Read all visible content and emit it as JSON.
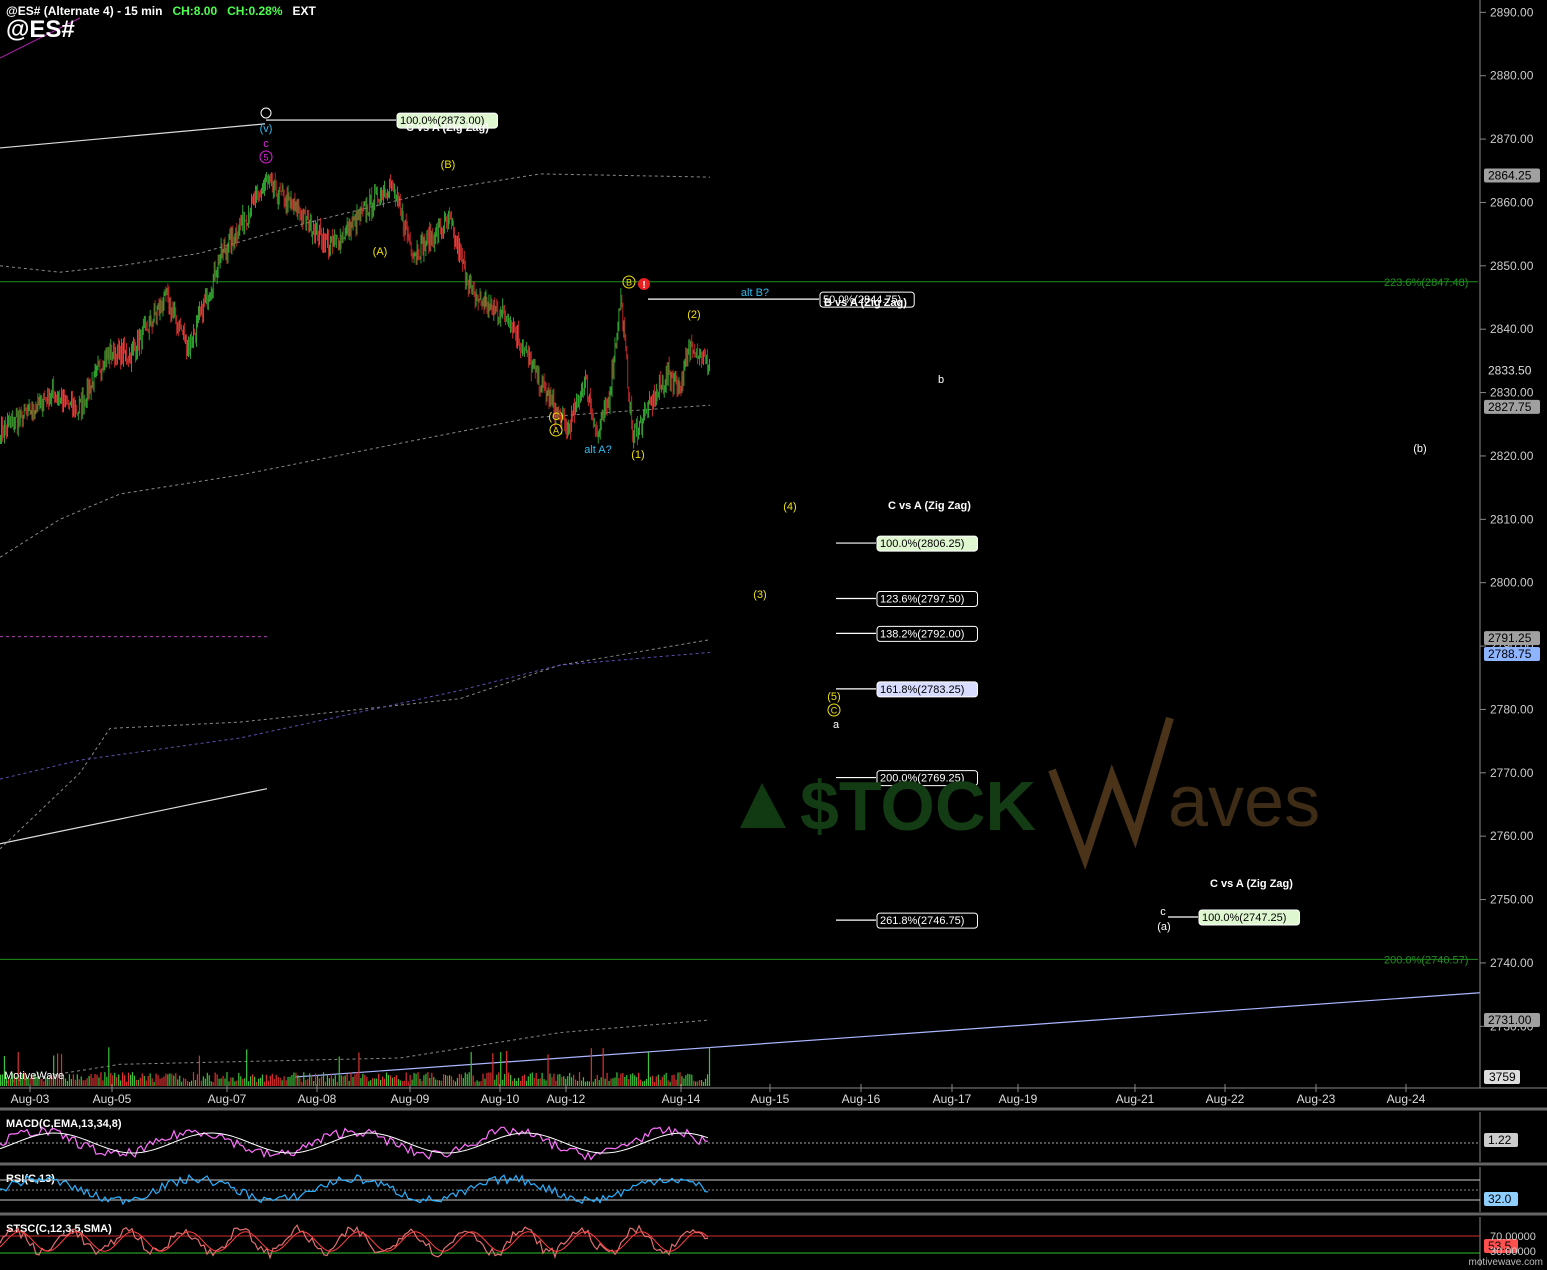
{
  "header": {
    "title": "@ES# (Alternate 4) - 15 min",
    "change_points": "CH:8.00",
    "change_pct": "CH:0.28%",
    "session": "EXT",
    "symbol": "@ES#"
  },
  "watermark": {
    "text_left": "$TOCK",
    "text_right": "aves",
    "logo_letter": "W"
  },
  "platform_label": "MotiveWave",
  "footer_credit": "motivewave.com",
  "colors": {
    "background": "#000000",
    "up_bar": "#3ac43a",
    "down_bar": "#e03030",
    "wave_yellow": "#f0e010",
    "wave_cyan": "#33bbee",
    "wave_magenta": "#e020e0",
    "fib_green_line": "#1f8f1f"
  },
  "chart_data": {
    "type": "candlestick",
    "timeframe": "15 min",
    "ylim": [
      2722,
      2891
    ],
    "y_ticks": [
      2730,
      2740,
      2750,
      2760,
      2770,
      2780,
      2790,
      2800,
      2810,
      2820,
      2830,
      2840,
      2850,
      2860,
      2870,
      2880,
      2890
    ],
    "x_ticks": [
      "Aug-03",
      "Aug-05",
      "Aug-07",
      "Aug-08",
      "Aug-09",
      "Aug-10",
      "Aug-12",
      "Aug-14",
      "Aug-15",
      "Aug-16",
      "Aug-17",
      "Aug-19",
      "Aug-21",
      "Aug-22",
      "Aug-23",
      "Aug-24"
    ],
    "price_path": [
      [
        0,
        2824
      ],
      [
        5,
        2827
      ],
      [
        9,
        2830
      ],
      [
        13,
        2827
      ],
      [
        18,
        2836
      ],
      [
        22,
        2836
      ],
      [
        28,
        2845
      ],
      [
        32,
        2837
      ],
      [
        37,
        2851
      ],
      [
        41,
        2857
      ],
      [
        45,
        2863
      ],
      [
        50,
        2859
      ],
      [
        56,
        2853
      ],
      [
        62,
        2859
      ],
      [
        66,
        2863
      ],
      [
        70,
        2852
      ],
      [
        76,
        2857
      ],
      [
        80,
        2845
      ],
      [
        86,
        2842
      ],
      [
        90,
        2834
      ],
      [
        94,
        2827
      ],
      [
        96,
        2824
      ],
      [
        99,
        2832
      ],
      [
        101,
        2823
      ],
      [
        103,
        2829
      ],
      [
        105,
        2845
      ],
      [
        107,
        2823
      ],
      [
        110,
        2828
      ],
      [
        113,
        2833
      ],
      [
        115,
        2831
      ],
      [
        117,
        2838
      ],
      [
        120,
        2834
      ]
    ],
    "price_axis_labels": [
      {
        "label": "2864.25",
        "value": 2864.25,
        "color": "#a0a0a0"
      },
      {
        "label": "2833.50",
        "value": 2833.5,
        "color": "#000000"
      },
      {
        "label": "2827.75",
        "value": 2827.75,
        "color": "#a0a0a0"
      },
      {
        "label": "2791.25",
        "value": 2791.25,
        "color": "#a0a0a0"
      },
      {
        "label": "2788.75",
        "value": 2788.75,
        "color": "#8fb4ff"
      },
      {
        "label": "2731.00",
        "value": 2731.0,
        "color": "#a0a0a0"
      }
    ],
    "horizontal_levels": [
      {
        "label": "223.6%(2847.48)",
        "value": 2847.48
      },
      {
        "label": "200.0%(2740.57)",
        "value": 2740.57
      }
    ],
    "fib_boxes": [
      {
        "label": "100.0%(2873.00)",
        "value": 2873.0,
        "style": "green"
      },
      {
        "label": "50.0%(2844.75)",
        "value": 2844.75,
        "style": "dark"
      },
      {
        "label": "100.0%(2806.25)",
        "value": 2806.25,
        "style": "green"
      },
      {
        "label": "123.6%(2797.50)",
        "value": 2797.5,
        "style": "dark"
      },
      {
        "label": "138.2%(2792.00)",
        "value": 2792.0,
        "style": "dark"
      },
      {
        "label": "161.8%(2783.25)",
        "value": 2783.25,
        "style": "blue"
      },
      {
        "label": "200.0%(2769.25)",
        "value": 2769.25,
        "style": "dark"
      },
      {
        "label": "261.8%(2746.75)",
        "value": 2746.75,
        "style": "dark"
      },
      {
        "label": "100.0%(2747.25)",
        "value": 2747.25,
        "style": "green"
      }
    ],
    "fib_titles": [
      {
        "label": "C vs A (Zig Zag)"
      },
      {
        "label": "B vs A (Zig Zag)"
      },
      {
        "label": "C vs A (Zig Zag)"
      },
      {
        "label": "C vs A (Zig Zag)"
      }
    ],
    "wave_labels": [
      {
        "label": "(v)",
        "color": "#33bbee"
      },
      {
        "label": "c",
        "color": "#e020e0"
      },
      {
        "label": "5",
        "color": "#e020e0"
      },
      {
        "label": "(B)",
        "color": "#f0e010"
      },
      {
        "label": "(A)",
        "color": "#f0e010"
      },
      {
        "label": "B",
        "color": "#f0e010"
      },
      {
        "label": "alt B?",
        "color": "#33bbee"
      },
      {
        "label": "(2)",
        "color": "#f0e010"
      },
      {
        "label": "(C)",
        "color": "#f0e010"
      },
      {
        "label": "A",
        "color": "#f0e010"
      },
      {
        "label": "alt A?",
        "color": "#33bbee"
      },
      {
        "label": "(1)",
        "color": "#f0e010"
      },
      {
        "label": "b",
        "color": "#ffffff"
      },
      {
        "label": "(b)",
        "color": "#ffffff"
      },
      {
        "label": "(4)",
        "color": "#f0e010"
      },
      {
        "label": "(3)",
        "color": "#f0e010"
      },
      {
        "label": "(5)",
        "color": "#f0e010"
      },
      {
        "label": "C",
        "color": "#f0e010"
      },
      {
        "label": "a",
        "color": "#ffffff"
      },
      {
        "label": "c",
        "color": "#ffffff"
      },
      {
        "label": "(a)",
        "color": "#ffffff"
      }
    ],
    "volume_label": "3759",
    "indicators": [
      {
        "name": "MACD(C,EMA,13,34,8)",
        "value_label": "1.22"
      },
      {
        "name": "RSI(C,13)",
        "value_label": "32.0"
      },
      {
        "name": "STSC(C,12,3,5,SMA)",
        "value_label": "53.5",
        "upper_label": "70.00000",
        "lower_label": "30.00000"
      }
    ]
  }
}
